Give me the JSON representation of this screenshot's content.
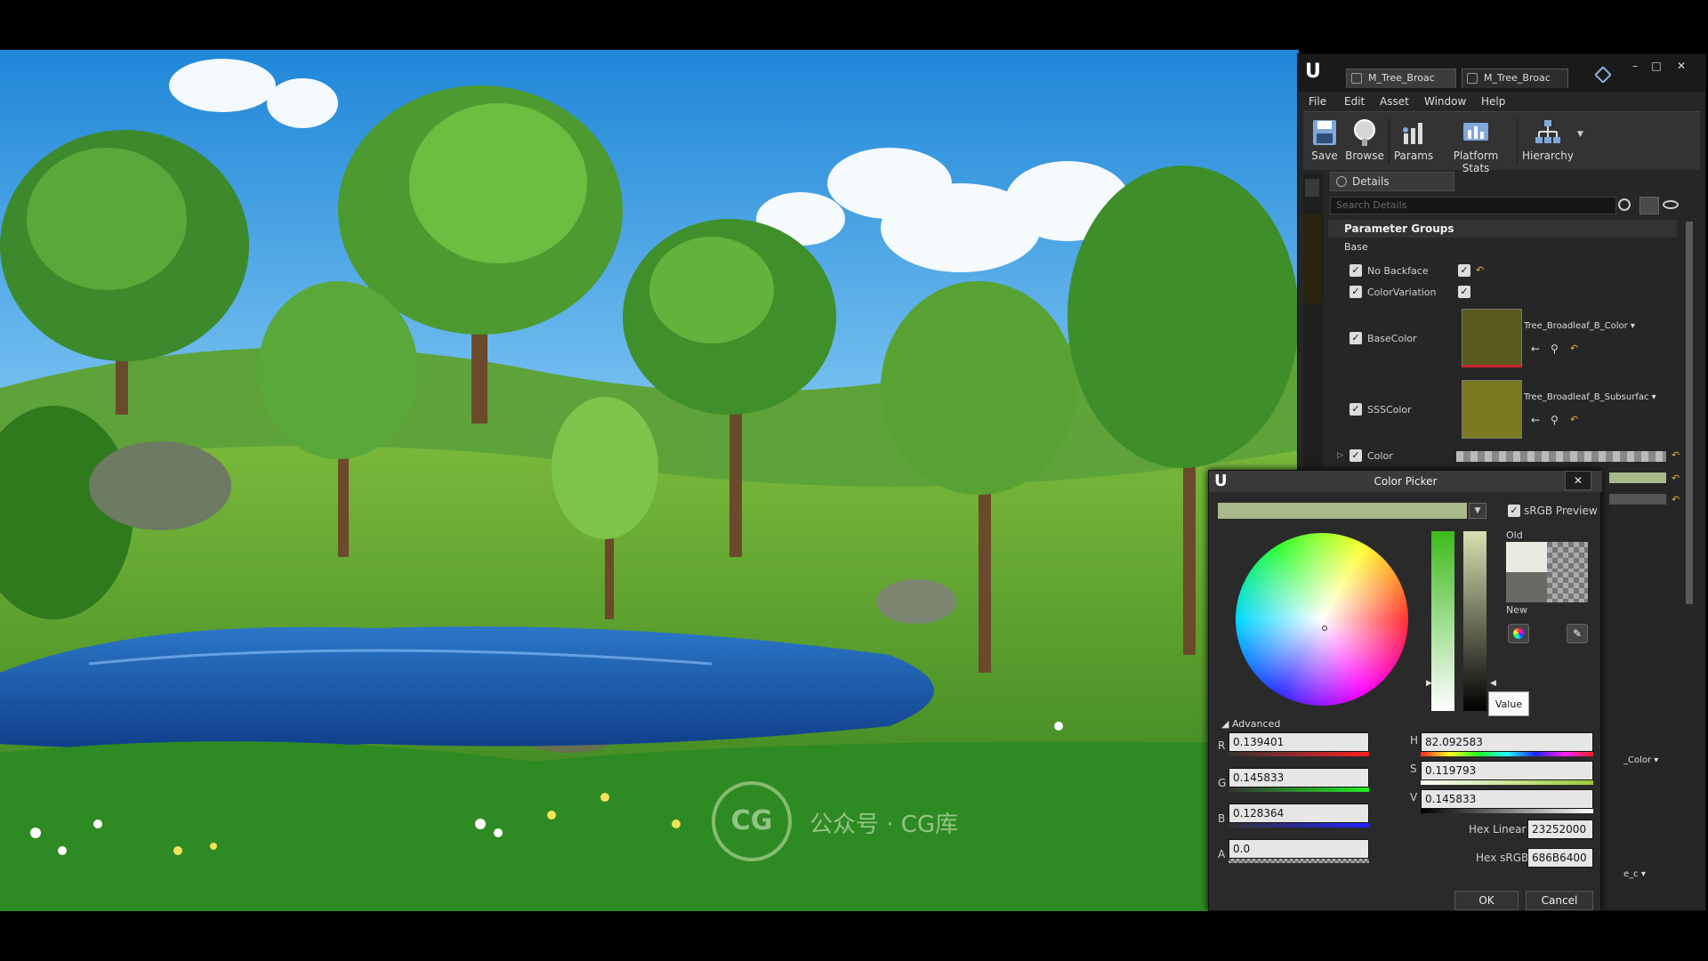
{
  "editor": {
    "tabs": [
      "M_Tree_Broac",
      "M_Tree_Broac"
    ],
    "menu": [
      "File",
      "Edit",
      "Asset",
      "Window",
      "Help"
    ],
    "toolbar": [
      "Save",
      "Browse",
      "Params",
      "Platform Stats",
      "Hierarchy"
    ],
    "details_tab": "Details",
    "search_placeholder": "Search Details",
    "section_title": "Parameter Groups",
    "group_title": "Base",
    "params": {
      "no_backface": "No Backface",
      "color_variation": "ColorVariation",
      "base_color": "BaseColor",
      "base_color_texture": "Tree_Broadleaf_B_Color",
      "sss_color": "SSSColor",
      "sss_color_texture": "Tree_Broadleaf_B_Subsurfac",
      "color": "Color"
    },
    "side_crop_labels": {
      "color_tex": "_Color",
      "c_tex": "e_c"
    }
  },
  "color_picker": {
    "title": "Color Picker",
    "srgb_preview": "sRGB Preview",
    "old_label": "Old",
    "new_label": "New",
    "value_button": "Value",
    "advanced": "Advanced",
    "labels": {
      "r": "R",
      "g": "G",
      "b": "B",
      "a": "A",
      "h": "H",
      "s": "S",
      "v": "V"
    },
    "values": {
      "r": "0.139401",
      "g": "0.145833",
      "b": "0.128364",
      "a": "0.0",
      "h": "82.092583",
      "s": "0.119793",
      "v": "0.145833"
    },
    "hex_linear_label": "Hex Linear",
    "hex_linear": "23252000",
    "hex_srgb_label": "Hex sRGB",
    "hex_srgb": "686B6400",
    "ok": "OK",
    "cancel": "Cancel",
    "colors": {
      "current": "#A8B98A",
      "old": "#E9EAE0",
      "new": "#686B64"
    }
  },
  "watermark": {
    "logo": "CG",
    "text": "公众号 · CG库"
  }
}
